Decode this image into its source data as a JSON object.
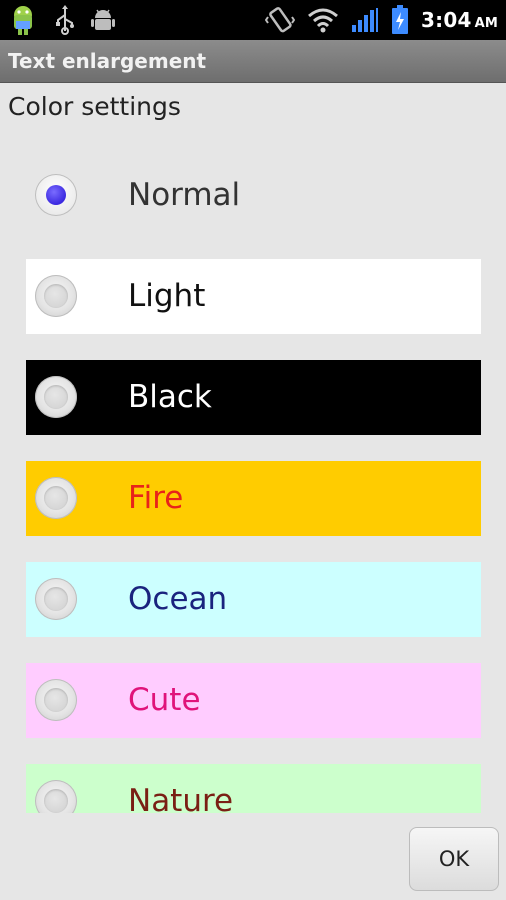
{
  "status_bar": {
    "time": "3:04",
    "ampm": "AM",
    "icons": [
      "android-icon",
      "usb-icon",
      "debug-icon",
      "vibrate-icon",
      "wifi-icon",
      "signal-icon",
      "battery-charging-icon"
    ]
  },
  "title_bar": {
    "title": "Text enlargement"
  },
  "section": {
    "title": "Color settings"
  },
  "options": [
    {
      "label": "Normal",
      "bg": "#e6e6e6",
      "fg": "#333333",
      "checked": true
    },
    {
      "label": "Light",
      "bg": "#ffffff",
      "fg": "#111111",
      "checked": false
    },
    {
      "label": "Black",
      "bg": "#000000",
      "fg": "#ffffff",
      "checked": false
    },
    {
      "label": "Fire",
      "bg": "#ffcc00",
      "fg": "#e8231a",
      "checked": false
    },
    {
      "label": "Ocean",
      "bg": "#ccffff",
      "fg": "#1a237e",
      "checked": false
    },
    {
      "label": "Cute",
      "bg": "#ffccff",
      "fg": "#e0137a",
      "checked": false
    },
    {
      "label": "Nature",
      "bg": "#ccffcc",
      "fg": "#7a1f14",
      "checked": false
    }
  ],
  "buttons": {
    "ok_label": "OK"
  },
  "colors": {
    "selected_radio": "#3b29e0",
    "title_bar": "#7d7d7d",
    "background": "#e6e6e6"
  }
}
